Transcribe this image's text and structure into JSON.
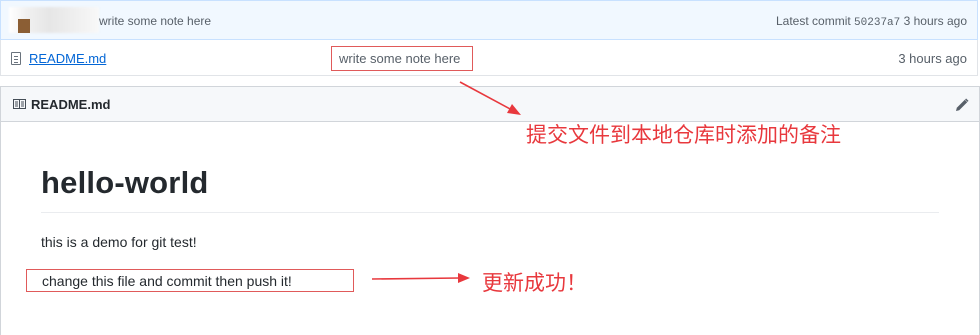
{
  "commit": {
    "message": "write some note here",
    "latest_label": "Latest commit",
    "sha": "50237a7",
    "age": "3 hours ago"
  },
  "file": {
    "name": "README.md",
    "message": "write some note here",
    "age": "3 hours ago"
  },
  "readme": {
    "header_title": "README.md",
    "heading": "hello-world",
    "paragraph1": "this is a demo for git test!",
    "paragraph2": "change this file and commit then push it!"
  },
  "annotations": {
    "note1": "提交文件到本地仓库时添加的备注",
    "note2": "更新成功！",
    "color": "#e8383d"
  },
  "icons": {
    "file": "file-icon",
    "book": "book-icon",
    "edit": "pencil-icon"
  }
}
